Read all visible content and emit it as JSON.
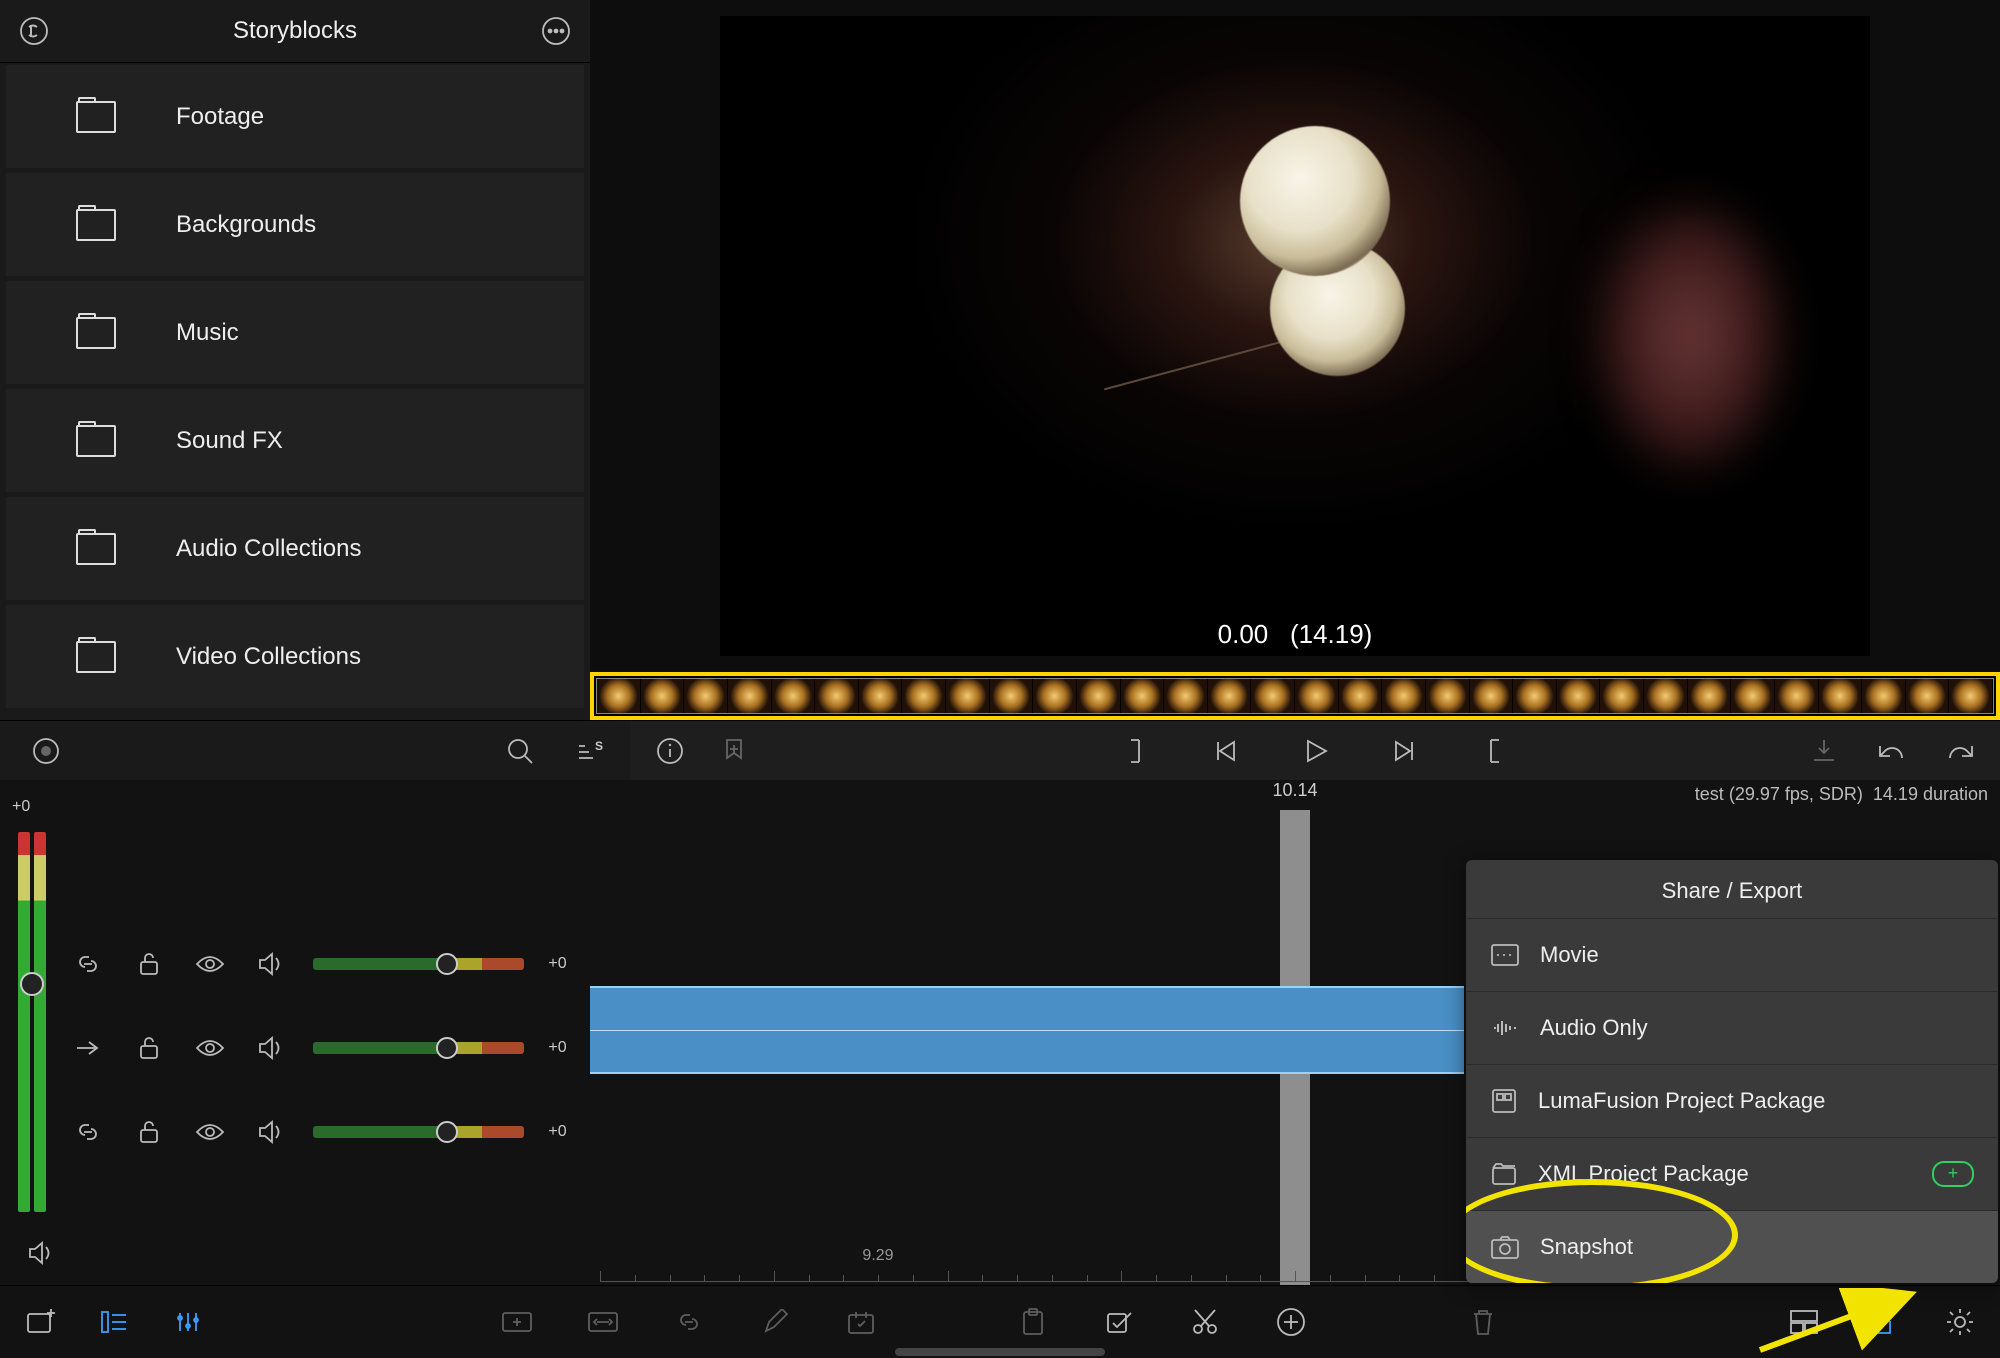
{
  "sidebar": {
    "title": "Storyblocks",
    "items": [
      {
        "label": "Footage"
      },
      {
        "label": "Backgrounds"
      },
      {
        "label": "Music"
      },
      {
        "label": "Sound FX"
      },
      {
        "label": "Audio Collections"
      },
      {
        "label": "Video Collections"
      }
    ]
  },
  "preview": {
    "time_current": "0.00",
    "time_total": "(14.19)"
  },
  "timeline": {
    "playhead_time": "10.14",
    "ruler_label": "9.29",
    "level_header": "+0",
    "tracks": [
      {
        "gain": "+0"
      },
      {
        "gain": "+0"
      },
      {
        "gain": "+0"
      }
    ]
  },
  "project": {
    "name": "test",
    "info_suffix": "(29.97 fps, SDR)",
    "duration_label": "14.19 duration"
  },
  "share": {
    "title": "Share / Export",
    "items": [
      {
        "label": "Movie"
      },
      {
        "label": "Audio Only"
      },
      {
        "label": "LumaFusion Project Package"
      },
      {
        "label": "XML Project Package"
      },
      {
        "label": "Snapshot"
      }
    ],
    "badge_plus": "+"
  }
}
